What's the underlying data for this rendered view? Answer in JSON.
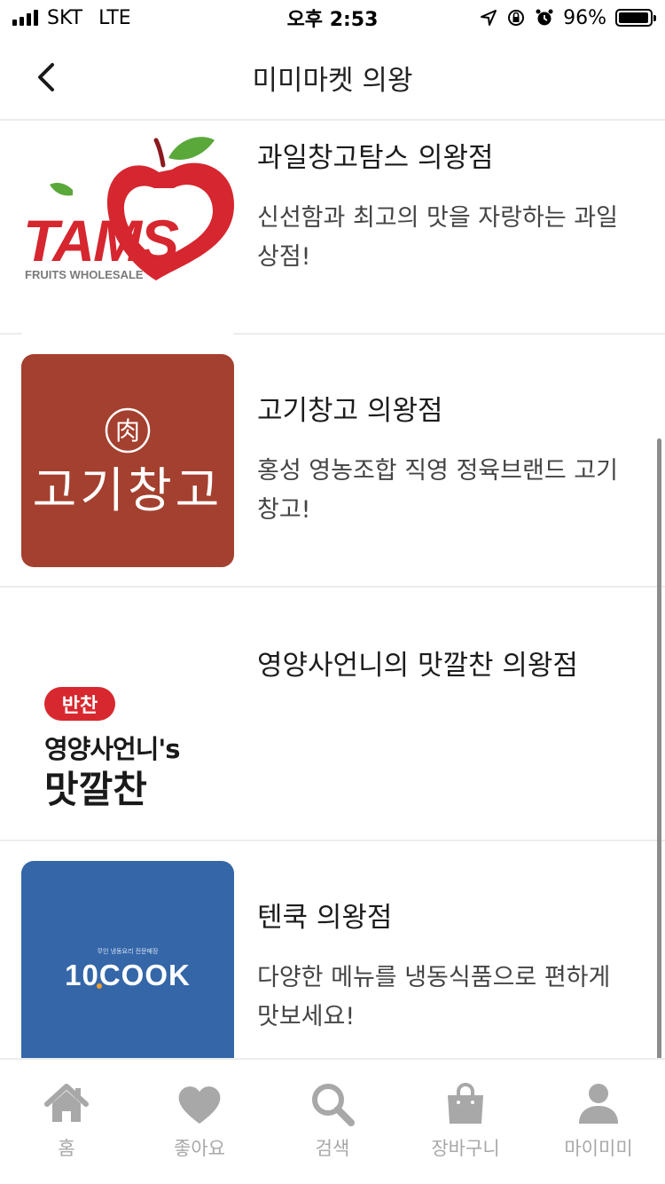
{
  "status_bar": {
    "carrier": "SKT",
    "network": "LTE",
    "time": "오후 2:53",
    "battery_text": "96%",
    "battery_level": 0.96
  },
  "header": {
    "title": "미미마켓 의왕",
    "back_icon": "chevron-left-icon"
  },
  "stores": [
    {
      "name": "과일창고탐스 의왕점",
      "description": "신선함과 최고의 맛을 자랑하는 과일 상점!",
      "logo": {
        "type": "tams",
        "brand": "TAMS",
        "tagline": "FRUITS WHOLESALE",
        "colors": {
          "primary": "#d6262f",
          "leaf": "#5aa83a"
        }
      }
    },
    {
      "name": "고기창고 의왕점",
      "description": "홍성 영농조합 직영 정육브랜드 고기창고!",
      "logo": {
        "type": "gogi",
        "symbol": "肉",
        "brand": "고기창고",
        "colors": {
          "background": "#a4402f",
          "text": "#ffffff"
        }
      }
    },
    {
      "name": "영양사언니의 맛깔찬 의왕점",
      "description": "",
      "logo": {
        "type": "banchan",
        "badge": "반찬",
        "line1": "영양사언니's",
        "line2": "맛깔찬",
        "colors": {
          "badge": "#d8282f",
          "text": "#1a1a1a"
        }
      }
    },
    {
      "name": "텐쿡 의왕점",
      "description": "다양한 메뉴를 냉동식품으로 편하게 맛보세요!",
      "logo": {
        "type": "tencook",
        "small_text": "무인 냉동요리 전문매장",
        "brand": "10COOK",
        "colors": {
          "background": "#3466a8",
          "text": "#ffffff",
          "accent": "#f2a12b"
        }
      }
    }
  ],
  "tabs": [
    {
      "label": "홈",
      "icon": "home-icon"
    },
    {
      "label": "좋아요",
      "icon": "heart-icon"
    },
    {
      "label": "검색",
      "icon": "search-icon"
    },
    {
      "label": "장바구니",
      "icon": "shopping-bag-icon"
    },
    {
      "label": "마이미미",
      "icon": "user-icon"
    }
  ],
  "colors": {
    "tab_inactive": "#a8a8a8",
    "divider": "#ececec"
  }
}
